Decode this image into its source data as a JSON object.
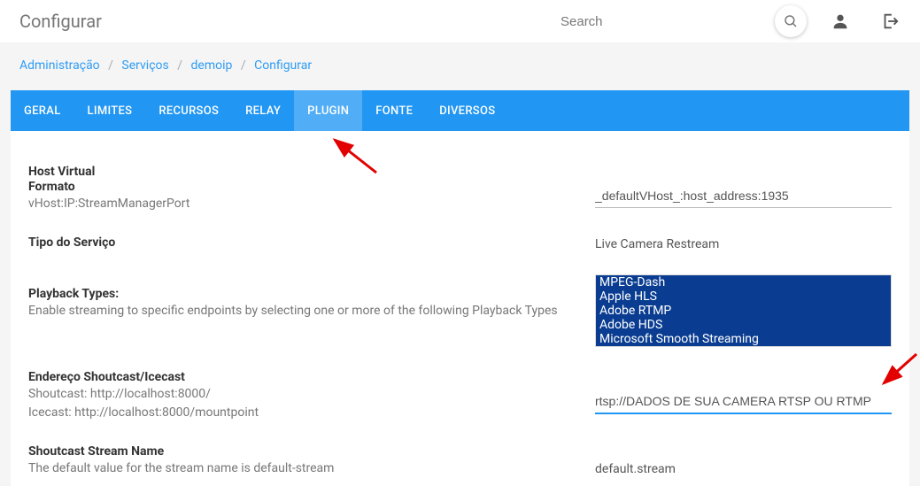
{
  "header": {
    "title": "Configurar",
    "search_placeholder": "Search"
  },
  "breadcrumb": {
    "items": [
      "Administração",
      "Serviços",
      "demoip",
      "Configurar"
    ]
  },
  "tabs": [
    "GERAL",
    "LIMITES",
    "RECURSOS",
    "RELAY",
    "PLUGIN",
    "FONTE",
    "DIVERSOS"
  ],
  "active_tab_index": 4,
  "fields": {
    "vhost": {
      "title": "Host Virtual",
      "subtitle": "Formato",
      "desc": "vHost:IP:StreamManagerPort",
      "value": "_defaultVHost_:host_address:1935"
    },
    "service_type": {
      "title": "Tipo do Serviço",
      "value": "Live Camera Restream"
    },
    "playback": {
      "title": "Playback Types:",
      "desc": "Enable streaming to specific endpoints by selecting one or more of the following Playback Types",
      "options": [
        "MPEG-Dash",
        "Apple HLS",
        "Adobe RTMP",
        "Adobe HDS",
        "Microsoft Smooth Streaming"
      ]
    },
    "shoutcast": {
      "title": "Endereço Shoutcast/Icecast",
      "line1": "Shoutcast: http://localhost:8000/",
      "line2": "Icecast: http://localhost:8000/mountpoint",
      "value": "rtsp://DADOS DE SUA CAMERA RTSP OU RTMP"
    },
    "stream_name": {
      "title": "Shoutcast Stream Name",
      "desc": "The default value for the stream name is default-stream",
      "value": "default.stream"
    }
  }
}
